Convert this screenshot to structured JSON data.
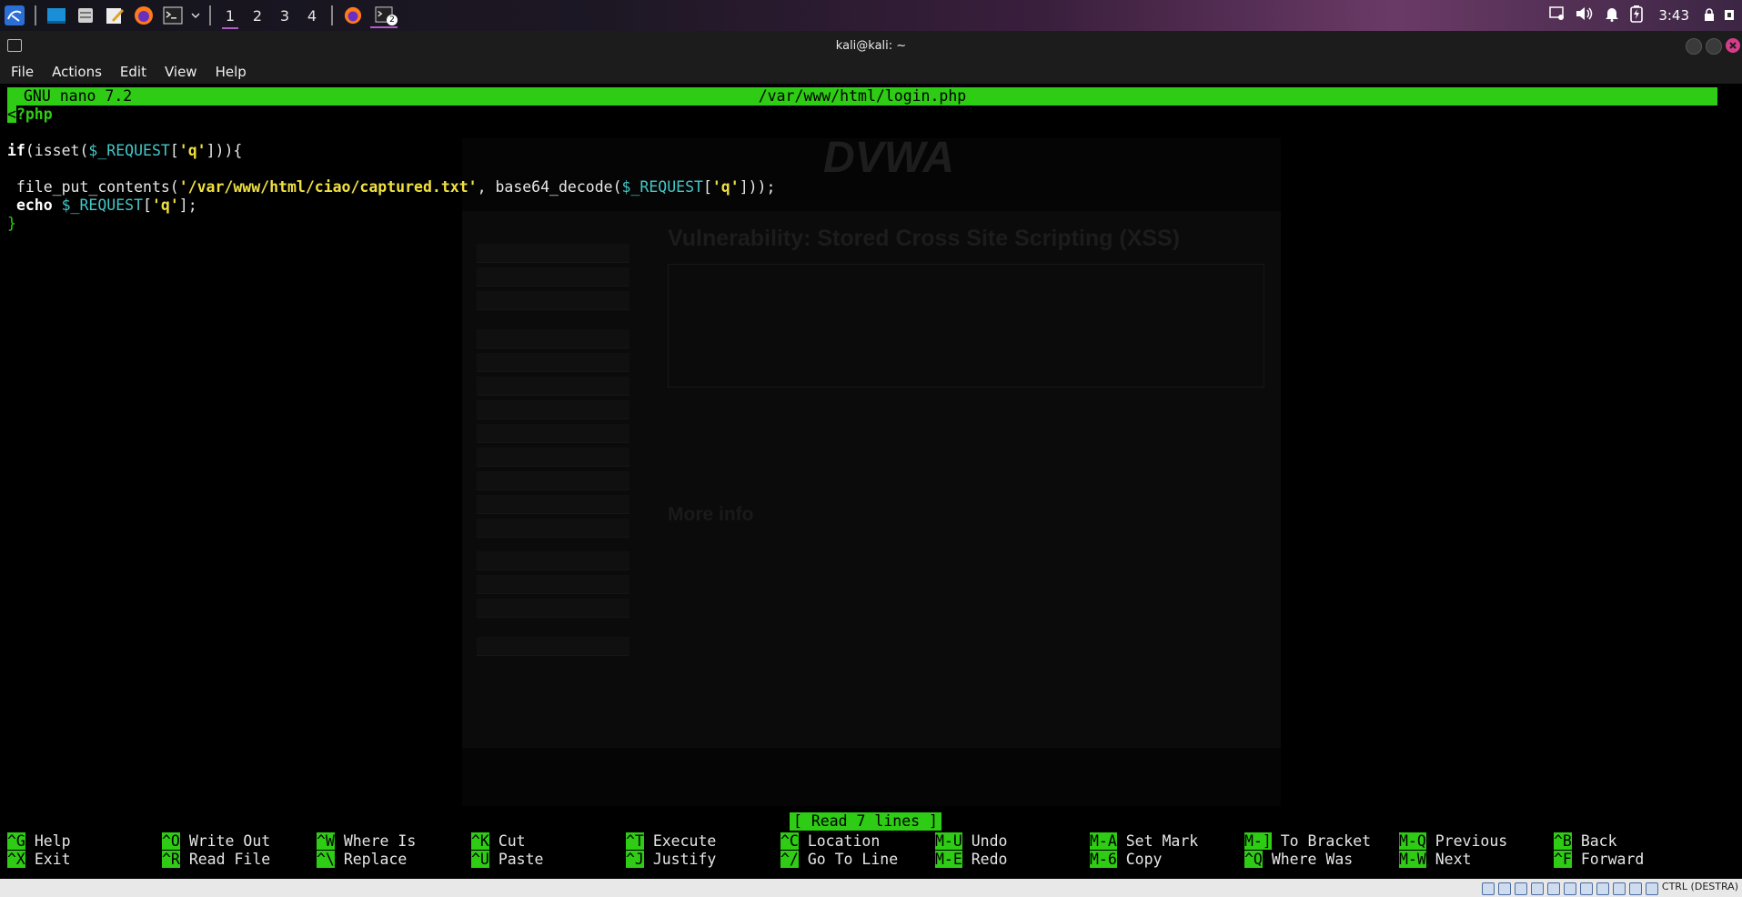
{
  "panel": {
    "workspaces": [
      "1",
      "2",
      "3",
      "4"
    ],
    "active_workspace": 0,
    "terminal_badge": "2",
    "clock": "3:43"
  },
  "window": {
    "title": "kali@kali: ~",
    "menu": [
      "File",
      "Actions",
      "Edit",
      "View",
      "Help"
    ]
  },
  "nano": {
    "version": "GNU nano 7.2",
    "filename": "/var/www/html/login.php",
    "status": "[ Read 7 lines ]",
    "lines": {
      "l1_tag_first": "<",
      "l1_tag_rest": "?php",
      "l3_if": "if",
      "l3_a": "(isset(",
      "l3_var": "$_REQUEST",
      "l3_b": "[",
      "l3_str": "'q'",
      "l3_c": "])){",
      "l5_fn": " file_put_contents(",
      "l5_str1": "'/var/www/html/ciao/captured.txt'",
      "l5_mid": ", base64_decode(",
      "l5_var": "$_REQUEST",
      "l5_b": "[",
      "l5_str2": "'q'",
      "l5_end": "]));",
      "l6_echo": "echo",
      "l6_var": "$_REQUEST",
      "l6_b": "[",
      "l6_str": "'q'",
      "l6_end": "];",
      "l7": "}"
    },
    "shortcuts_row1": [
      {
        "key": "^G",
        "label": "Help"
      },
      {
        "key": "^O",
        "label": "Write Out"
      },
      {
        "key": "^W",
        "label": "Where Is"
      },
      {
        "key": "^K",
        "label": "Cut"
      },
      {
        "key": "^T",
        "label": "Execute"
      },
      {
        "key": "^C",
        "label": "Location"
      },
      {
        "key": "M-U",
        "label": "Undo"
      },
      {
        "key": "M-A",
        "label": "Set Mark"
      },
      {
        "key": "M-]",
        "label": "To Bracket"
      },
      {
        "key": "M-Q",
        "label": "Previous"
      },
      {
        "key": "^B",
        "label": "Back"
      }
    ],
    "shortcuts_row2": [
      {
        "key": "^X",
        "label": "Exit"
      },
      {
        "key": "^R",
        "label": "Read File"
      },
      {
        "key": "^\\",
        "label": "Replace"
      },
      {
        "key": "^U",
        "label": "Paste"
      },
      {
        "key": "^J",
        "label": "Justify"
      },
      {
        "key": "^/",
        "label": "Go To Line"
      },
      {
        "key": "M-E",
        "label": "Redo"
      },
      {
        "key": "M-6",
        "label": "Copy"
      },
      {
        "key": "^Q",
        "label": "Where Was"
      },
      {
        "key": "M-W",
        "label": "Next"
      },
      {
        "key": "^F",
        "label": "Forward"
      }
    ]
  },
  "ghost_browser": {
    "logo": "DVWA",
    "heading": "Vulnerability: Stored Cross Site Scripting (XSS)",
    "more_info": "More info"
  },
  "host_status": {
    "text": "CTRL (DESTRA)"
  },
  "colors": {
    "nano_green": "#2ecc14",
    "string_yellow": "#f0e040",
    "variable_cyan": "#44c7c7"
  }
}
